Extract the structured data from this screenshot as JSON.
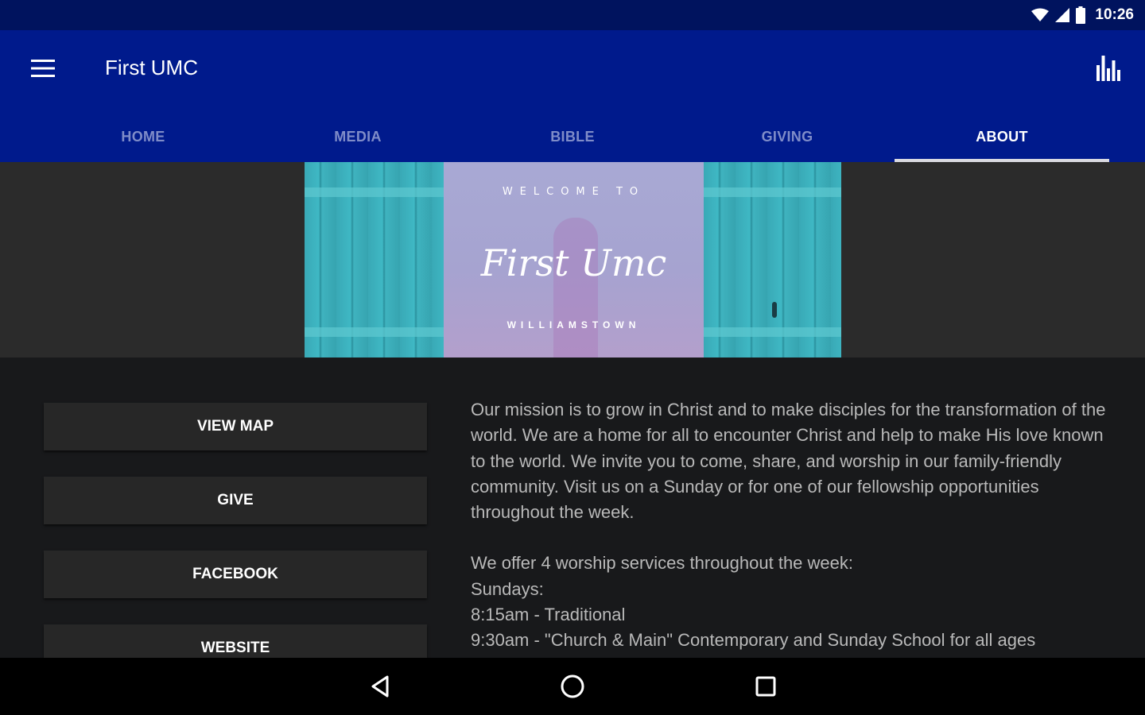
{
  "status_bar": {
    "time": "10:26",
    "icons": [
      "wifi-icon",
      "signal-icon",
      "battery-icon"
    ]
  },
  "app_bar": {
    "title": "First UMC",
    "menu_icon": "menu-icon",
    "action_icon": "bar-chart-icon"
  },
  "tabs": [
    {
      "label": "HOME",
      "active": false
    },
    {
      "label": "MEDIA",
      "active": false
    },
    {
      "label": "BIBLE",
      "active": false
    },
    {
      "label": "GIVING",
      "active": false
    },
    {
      "label": "ABOUT",
      "active": true
    }
  ],
  "banner": {
    "welcome": "WELCOME TO",
    "name": "First Umc",
    "town": "WILLIAMSTOWN"
  },
  "actions": [
    {
      "label": "VIEW MAP"
    },
    {
      "label": "GIVE"
    },
    {
      "label": "FACEBOOK"
    },
    {
      "label": "WEBSITE"
    }
  ],
  "about": {
    "mission": "Our mission is to grow in Christ and to make disciples for the transformation of the world. We are a home for all to encounter Christ and help to make His love known to the world. We invite you to come, share, and worship in our family-friendly community. Visit us on a Sunday or for one of our fellowship opportunities throughout the week.",
    "services_intro": "We offer 4 worship services throughout the week:",
    "sundays_label": "Sundays:",
    "service_1": "8:15am - Traditional",
    "service_2": "9:30am - \"Church & Main\" Contemporary and Sunday School for all ages"
  },
  "nav_bar": {
    "icons": [
      "back-icon",
      "home-circle-icon",
      "recents-icon"
    ]
  },
  "colors": {
    "status_bar": "#00135e",
    "app_bar": "#001a8c",
    "tab_inactive": "#7f8cc8",
    "content_bg": "#18191b",
    "button_bg": "#272727",
    "body_text": "#b9b9b9"
  }
}
